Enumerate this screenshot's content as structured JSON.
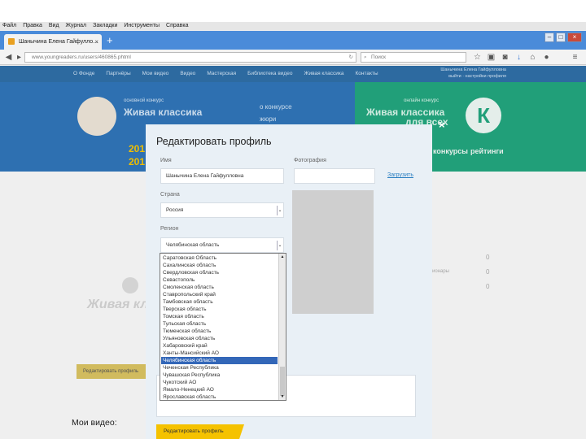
{
  "menubar": [
    "Файл",
    "Правка",
    "Вид",
    "Журнал",
    "Закладки",
    "Инструменты",
    "Справка"
  ],
  "tab": {
    "title": "Шанычина Елена Гайфулло..."
  },
  "address": {
    "url": "www.youngreaders.ru/users/460865.phtml",
    "search_placeholder": "Поиск"
  },
  "site": {
    "nav": [
      "О Фонде",
      "Партнёры",
      "Мои видео",
      "Видео",
      "Мастерская",
      "Библиотека видео",
      "Живая классика",
      "Контакты"
    ],
    "user_line1": "Шанычина Елена Гайфулловна",
    "user_line2": "выйти · настройки профиля",
    "left_banner": {
      "kicker": "основной конкурс",
      "title": "Живая классика",
      "years1": "201",
      "years2": "201",
      "link1": "о конкурсе",
      "link2": "жюри"
    },
    "right_banner": {
      "kicker": "онлайн конкурс",
      "title": "Живая классика",
      "title2": "для всех",
      "logo_letter": "К",
      "link1": "конкурсы",
      "link2": "рейтинги"
    },
    "bg_title": "Живая клас",
    "bg_button": "Редактировать профиль",
    "my_videos": "Мои видео:",
    "bg_counts": [
      "0",
      "0",
      "0"
    ],
    "bg_side_label": "ионары"
  },
  "modal": {
    "title": "Редактировать профиль",
    "close": "×",
    "name_label": "Имя",
    "name_value": "Шанычина Елена Гайфулловна",
    "photo_label": "Фотография",
    "upload_link": "Загрузить",
    "country_label": "Страна",
    "country_value": "Россия",
    "region_label": "Регион",
    "region_value": "Челябинская область",
    "submit": "Редактировать профиль",
    "region_options": [
      "Саратовская Область",
      "Сахалинская область",
      "Свердловская область",
      "Севастополь",
      "Смоленская область",
      "Ставропольский край",
      "Тамбовская область",
      "Тверская область",
      "Томская область",
      "Тульская область",
      "Тюменская область",
      "Ульяновская область",
      "Хабаровский край",
      "Ханты-Мансийский АО",
      "Челябинская область",
      "Чеченская Республика",
      "Чувашская Республика",
      "Чукотский АО",
      "Ямало-Ненецкий АО",
      "Ярославская область"
    ],
    "selected_index": 14
  }
}
